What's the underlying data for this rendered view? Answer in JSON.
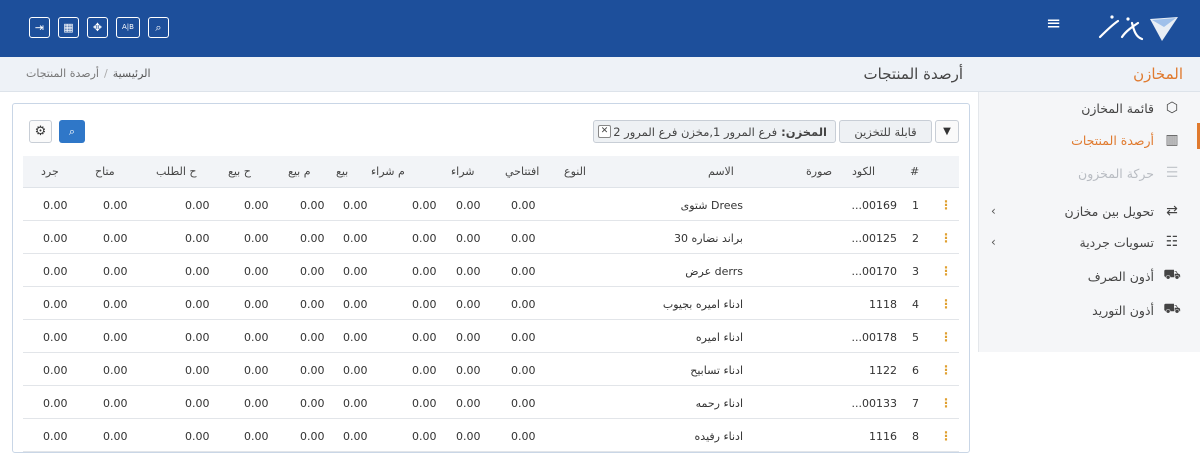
{
  "topbar": {
    "buttons": [
      {
        "name": "exit-icon",
        "glyph": "⇥"
      },
      {
        "name": "grid-icon",
        "glyph": "▦"
      },
      {
        "name": "move-icon",
        "glyph": "✥"
      },
      {
        "name": "language-icon",
        "glyph": "A|B"
      },
      {
        "name": "search-icon",
        "glyph": "⌕"
      }
    ],
    "menu_glyph": "≡"
  },
  "breadcrumb": {
    "home": "الرئيسية",
    "sep": "/",
    "current": "أرصدة المنتجات"
  },
  "page_title": "أرصدة المنتجات",
  "section_title": "المخازن",
  "sidebar": {
    "items": [
      {
        "label": "قائمة المخازن",
        "icon": "boxes-icon",
        "glyph": "⬡",
        "state": "normal"
      },
      {
        "label": "أرصدة المنتجات",
        "icon": "shelves-icon",
        "glyph": "▥",
        "state": "active"
      },
      {
        "label": "حركة المخزون",
        "icon": "lines-icon",
        "glyph": "☰",
        "state": "disabled"
      },
      {
        "label": "تحويل بين مخازن",
        "icon": "transfer-icon",
        "glyph": "⇄",
        "state": "normal",
        "has_children": true
      },
      {
        "label": "تسويات جردية",
        "icon": "checklist-icon",
        "glyph": "☷",
        "state": "normal",
        "has_children": true
      },
      {
        "label": "أذون الصرف",
        "icon": "dispatch-icon",
        "glyph": "⛟",
        "state": "normal"
      },
      {
        "label": "أذون التوريد",
        "icon": "receive-icon",
        "glyph": "⛟",
        "state": "normal"
      }
    ],
    "chevron": "‹"
  },
  "toolbar": {
    "settings_glyph": "⚙",
    "search_glyph": "⌕",
    "filter_glyph": "▼",
    "chip_storable": "قابلة للتخزين",
    "chip_warehouse_key": "المخزن:",
    "chip_warehouse_value": "فرع المرور 1,مخزن فرع المرور 2",
    "chip_close": "✕"
  },
  "table": {
    "columns": [
      "#",
      "الكود",
      "صورة",
      "الاسم",
      "النوع",
      "افتتاحي",
      "شراء",
      "م شراء",
      "بيع",
      "م بيع",
      "ح بيع",
      "ح الطلب",
      "متاح",
      "جرد"
    ],
    "rows": [
      {
        "num": "1",
        "code": "...00169",
        "name": "Drees شتوى",
        "vals": [
          "0.00",
          "0.00",
          "0.00",
          "0.00",
          "0.00",
          "0.00",
          "0.00",
          "0.00",
          "0.00"
        ]
      },
      {
        "num": "2",
        "code": "...00125",
        "name": "براند نضاره 30",
        "vals": [
          "0.00",
          "0.00",
          "0.00",
          "0.00",
          "0.00",
          "0.00",
          "0.00",
          "0.00",
          "0.00"
        ]
      },
      {
        "num": "3",
        "code": "...00170",
        "name": "derrs عرض",
        "vals": [
          "0.00",
          "0.00",
          "0.00",
          "0.00",
          "0.00",
          "0.00",
          "0.00",
          "0.00",
          "0.00"
        ]
      },
      {
        "num": "4",
        "code": "1118",
        "name": "ادناء اميره بجيوب",
        "vals": [
          "0.00",
          "0.00",
          "0.00",
          "0.00",
          "0.00",
          "0.00",
          "0.00",
          "0.00",
          "0.00"
        ]
      },
      {
        "num": "5",
        "code": "...00178",
        "name": "ادناء اميره",
        "vals": [
          "0.00",
          "0.00",
          "0.00",
          "0.00",
          "0.00",
          "0.00",
          "0.00",
          "0.00",
          "0.00"
        ]
      },
      {
        "num": "6",
        "code": "1122",
        "name": "ادناء تسابيح",
        "vals": [
          "0.00",
          "0.00",
          "0.00",
          "0.00",
          "0.00",
          "0.00",
          "0.00",
          "0.00",
          "0.00"
        ]
      },
      {
        "num": "7",
        "code": "...00133",
        "name": "ادناء رحمه",
        "vals": [
          "0.00",
          "0.00",
          "0.00",
          "0.00",
          "0.00",
          "0.00",
          "0.00",
          "0.00",
          "0.00"
        ]
      },
      {
        "num": "8",
        "code": "1116",
        "name": "ادناء رفيده",
        "vals": [
          "0.00",
          "0.00",
          "0.00",
          "0.00",
          "0.00",
          "0.00",
          "0.00",
          "0.00",
          "0.00"
        ]
      }
    ]
  },
  "colors": {
    "topbar": "#1d4f9b",
    "accent": "#e07a2e",
    "primary_button": "#2f77c8"
  }
}
